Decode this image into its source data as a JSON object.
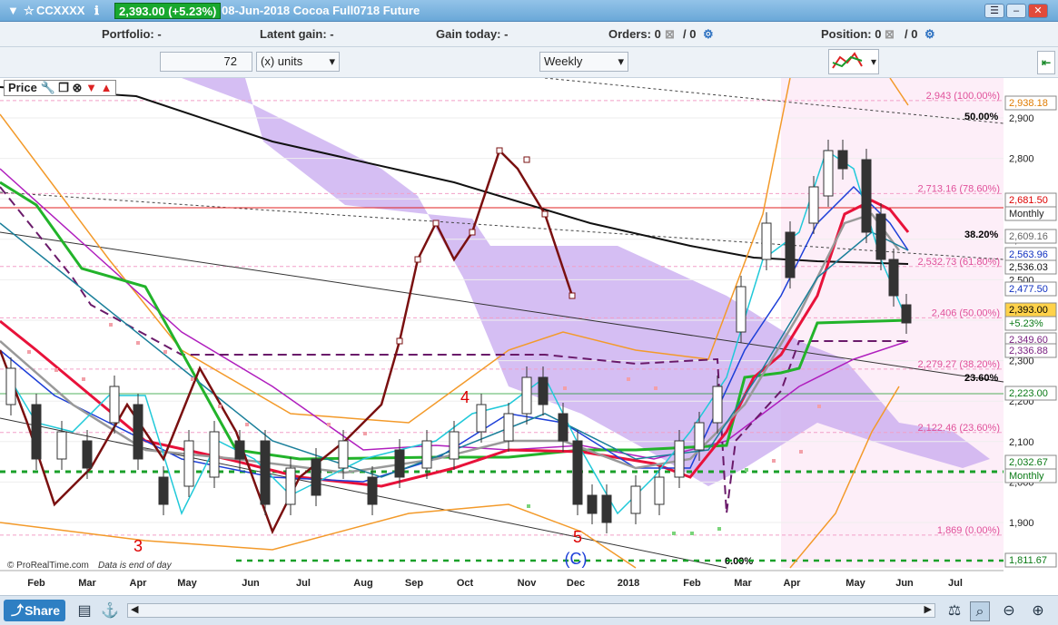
{
  "title": {
    "symbol": "CCXXXX",
    "price": "2,393.00 (+5.23%)",
    "desc": "08-Jun-2018 Cocoa Full0718 Future"
  },
  "toolbar": {
    "portfolio": "Portfolio: -",
    "latent": "Latent gain: -",
    "today": "Gain today: -",
    "orders": "Orders: 0",
    "orders2": "/ 0",
    "position": "Position: 0",
    "position2": "/ 0"
  },
  "units": {
    "value": "72",
    "unit": "(x) units",
    "period": "Weekly"
  },
  "legend": {
    "label": "Price"
  },
  "fib": [
    {
      "t": "2,943 (100.00%)",
      "c": "#e0509a"
    },
    {
      "t": "2,713.16 (78.60%)",
      "c": "#e0509a"
    },
    {
      "t": "2,532.73 (61.80%)",
      "c": "#e0509a"
    },
    {
      "t": "2,406 (50.00%)",
      "c": "#e0509a"
    },
    {
      "t": "2,279.27 (38.20%)",
      "c": "#e0509a"
    },
    {
      "t": "2,122.46 (23.60%)",
      "c": "#e0509a"
    },
    {
      "t": "1,869 (0.00%)",
      "c": "#e0509a"
    }
  ],
  "gann": {
    "a": "50.00%",
    "b": "38.20%",
    "c": "23.60%",
    "d": "0.00%"
  },
  "axis": {
    "ticks": [
      "2,900",
      "2,800",
      "2,700",
      "2,600",
      "2,500",
      "2,400",
      "2,300",
      "2,200",
      "2,100",
      "2,000",
      "1,900"
    ]
  },
  "pricelabels": [
    {
      "t": "2,938.18",
      "bg": "#fff",
      "c": "#e07b00"
    },
    {
      "t": "2,681.50",
      "bg": "#fff",
      "c": "#d00"
    },
    {
      "t": "Monthly",
      "bg": "#fff",
      "c": "#222"
    },
    {
      "t": "2,609.16",
      "bg": "#fff",
      "c": "#666"
    },
    {
      "t": "2,563.96",
      "bg": "#fff",
      "c": "#1030c0"
    },
    {
      "t": "2,536.03",
      "bg": "#fff",
      "c": "#111"
    },
    {
      "t": "2,477.50",
      "bg": "#fff",
      "c": "#1030c0"
    },
    {
      "t": "2,393.00",
      "bg": "#ffd24a",
      "c": "#000"
    },
    {
      "t": "+5.23%",
      "bg": "#fff",
      "c": "#0a7a16"
    },
    {
      "t": "2,349.60",
      "bg": "#fff",
      "c": "#7a2080"
    },
    {
      "t": "2,336.88",
      "bg": "#fff",
      "c": "#7a2080"
    },
    {
      "t": "2,223.00",
      "bg": "#fff",
      "c": "#0a7a16"
    },
    {
      "t": "2,032.67",
      "bg": "#fff",
      "c": "#0a7a16"
    },
    {
      "t": "Monthly",
      "bg": "#fff",
      "c": "#0a7a16"
    },
    {
      "t": "1,811.67",
      "bg": "#fff",
      "c": "#0a7a16"
    }
  ],
  "months": [
    "Feb",
    "Mar",
    "Apr",
    "May",
    "Jun",
    "Jul",
    "Aug",
    "Sep",
    "Oct",
    "Nov",
    "Dec",
    "2018",
    "Feb",
    "Mar",
    "Apr",
    "May",
    "Jun",
    "Jul"
  ],
  "waves": [
    "3",
    "4",
    "5",
    "(C)"
  ],
  "footer": {
    "brand": "© ProRealTime.com",
    "note": "Data is end of day"
  },
  "status": {
    "share": "Share"
  }
}
